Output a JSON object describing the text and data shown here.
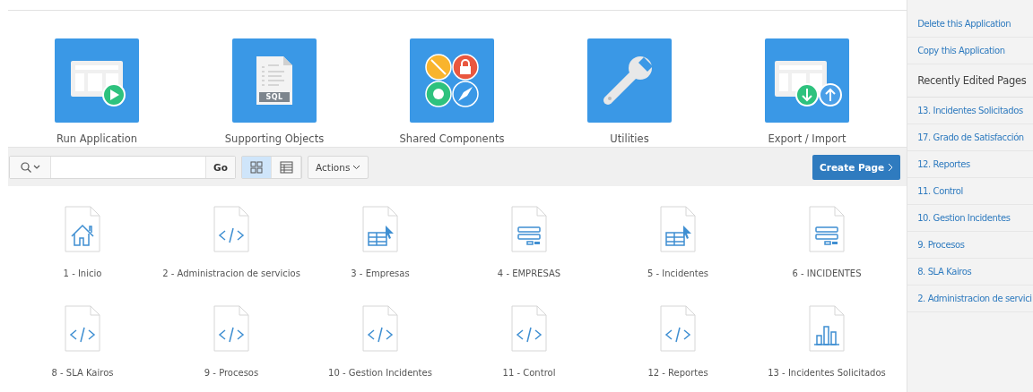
{
  "tiles": [
    {
      "kind": "run",
      "label": "Run Application"
    },
    {
      "kind": "sql",
      "label": "Supporting Objects",
      "badge": "SQL"
    },
    {
      "kind": "shared",
      "label": "Shared Components"
    },
    {
      "kind": "wrench",
      "label": "Utilities"
    },
    {
      "kind": "export",
      "label": "Export / Import"
    }
  ],
  "toolbar": {
    "go": "Go",
    "views": [
      {
        "kind": "icons",
        "selected": true
      },
      {
        "kind": "report",
        "selected": false
      }
    ],
    "actions": "Actions",
    "create": "Create Page"
  },
  "pages": [
    {
      "kind": "home",
      "label": "1 - Inicio"
    },
    {
      "kind": "code",
      "label": "2 - Administracion de servicios"
    },
    {
      "kind": "grid",
      "label": "3 - Empresas"
    },
    {
      "kind": "form",
      "label": "4 - EMPRESAS"
    },
    {
      "kind": "grid",
      "label": "5 - Incidentes"
    },
    {
      "kind": "form",
      "label": "6 - INCIDENTES"
    },
    {
      "kind": "code",
      "label": "8 - SLA Kairos"
    },
    {
      "kind": "code",
      "label": "9 - Procesos"
    },
    {
      "kind": "code",
      "label": "10 - Gestion Incidentes"
    },
    {
      "kind": "code",
      "label": "11 - Control"
    },
    {
      "kind": "code",
      "label": "12 - Reportes"
    },
    {
      "kind": "chart",
      "label": "13 - Incidentes Solicitados"
    }
  ],
  "sidebar": {
    "actions": [
      "Delete this Application",
      "Copy this Application"
    ],
    "recent_title": "Recently Edited Pages",
    "recent": [
      "13. Incidentes Solicitados",
      "17. Grado de Satisfacción",
      "12. Reportes",
      "11. Control",
      "10. Gestion Incidentes",
      "9. Procesos",
      "8. SLA Kairos",
      "2. Administracion de servici"
    ]
  }
}
